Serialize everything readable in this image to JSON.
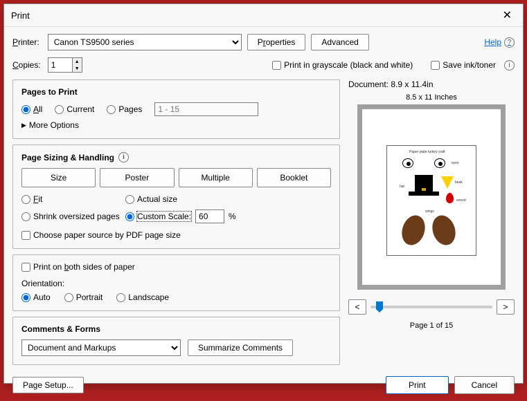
{
  "title": "Print",
  "help": "Help",
  "printer": {
    "label": "Printer:",
    "value": "Canon TS9500 series"
  },
  "properties_btn": "Properties",
  "advanced_btn": "Advanced",
  "copies": {
    "label": "Copies:",
    "value": "1"
  },
  "grayscale": "Print in grayscale (black and white)",
  "saveink": "Save ink/toner",
  "pages_to_print": {
    "title": "Pages to Print",
    "all": "All",
    "current": "Current",
    "pages": "Pages",
    "range_placeholder": "1 - 15",
    "more_options": "More Options"
  },
  "sizing": {
    "title": "Page Sizing & Handling",
    "size": "Size",
    "poster": "Poster",
    "multiple": "Multiple",
    "booklet": "Booklet",
    "fit": "Fit",
    "actual": "Actual size",
    "shrink": "Shrink oversized pages",
    "custom": "Custom Scale:",
    "scale_value": "60",
    "percent": "%",
    "choose_source": "Choose paper source by PDF page size",
    "both_sides": "Print on both sides of paper",
    "orientation_label": "Orientation:",
    "auto": "Auto",
    "portrait": "Portrait",
    "landscape": "Landscape"
  },
  "comments": {
    "title": "Comments & Forms",
    "selected": "Document and Markups",
    "summarize": "Summarize Comments"
  },
  "preview": {
    "doc_size": "Document: 8.9 x 11.4in",
    "page_size": "8.5 x 11 Inches",
    "prev": "<",
    "next": ">",
    "page_of": "Page 1 of 15"
  },
  "footer": {
    "page_setup": "Page Setup...",
    "print": "Print",
    "cancel": "Cancel"
  },
  "underlined": {
    "P": "P",
    "r": "r",
    "C": "C",
    "A": "A",
    "g": "g",
    "F": "F",
    "b": "b"
  }
}
